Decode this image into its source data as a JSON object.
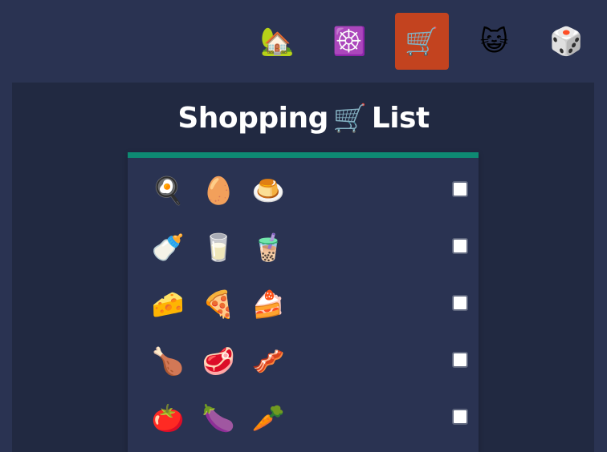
{
  "nav": {
    "items": [
      {
        "icon": "house-icon",
        "glyph": "🏡",
        "active": false
      },
      {
        "icon": "wheel-icon",
        "glyph": "☸️",
        "active": false
      },
      {
        "icon": "shopping-cart-icon",
        "glyph": "🛒",
        "active": true
      },
      {
        "icon": "cat-icon",
        "glyph": "😺",
        "active": false
      },
      {
        "icon": "dice-icon",
        "glyph": "🎲",
        "active": false
      }
    ],
    "active_color": "#c3431f"
  },
  "page": {
    "title_word1": "Shopping",
    "title_glyph": "🛒",
    "title_word2": "List"
  },
  "list": {
    "accent_color": "#0e8a73",
    "rows": [
      {
        "items": [
          {
            "icon": "fried-egg-pan-icon",
            "glyph": "🍳"
          },
          {
            "icon": "egg-icon",
            "glyph": "🥚"
          },
          {
            "icon": "flan-pudding-icon",
            "glyph": "🍮"
          }
        ],
        "checked": false
      },
      {
        "items": [
          {
            "icon": "baby-bottle-icon",
            "glyph": "🍼"
          },
          {
            "icon": "glass-of-milk-icon",
            "glyph": "🥛"
          },
          {
            "icon": "bubble-tea-icon",
            "glyph": "🧋"
          }
        ],
        "checked": false
      },
      {
        "items": [
          {
            "icon": "cheese-icon",
            "glyph": "🧀"
          },
          {
            "icon": "pizza-icon",
            "glyph": "🍕"
          },
          {
            "icon": "cake-slice-icon",
            "glyph": "🍰"
          }
        ],
        "checked": false
      },
      {
        "items": [
          {
            "icon": "poultry-leg-icon",
            "glyph": "🍗"
          },
          {
            "icon": "meat-icon",
            "glyph": "🥩"
          },
          {
            "icon": "bacon-icon",
            "glyph": "🥓"
          }
        ],
        "checked": false
      },
      {
        "items": [
          {
            "icon": "tomato-icon",
            "glyph": "🍅"
          },
          {
            "icon": "eggplant-icon",
            "glyph": "🍆"
          },
          {
            "icon": "carrot-icon",
            "glyph": "🥕"
          }
        ],
        "checked": false
      }
    ]
  }
}
